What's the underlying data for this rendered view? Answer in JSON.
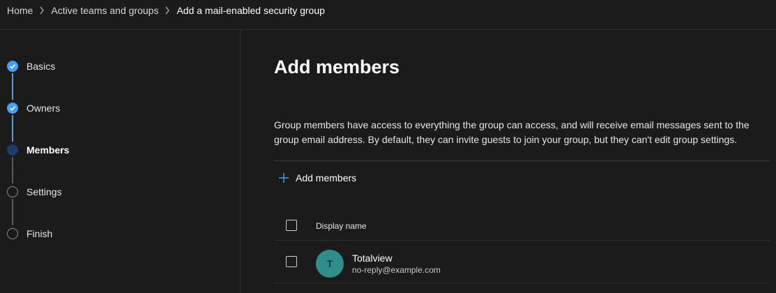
{
  "breadcrumb": {
    "items": [
      "Home",
      "Active teams and groups",
      "Add a mail-enabled security group"
    ]
  },
  "wizard": {
    "steps": [
      {
        "label": "Basics",
        "state": "completed"
      },
      {
        "label": "Owners",
        "state": "completed"
      },
      {
        "label": "Members",
        "state": "current"
      },
      {
        "label": "Settings",
        "state": "pending"
      },
      {
        "label": "Finish",
        "state": "pending"
      }
    ]
  },
  "main": {
    "title": "Add members",
    "description": "Group members have access to everything the group can access, and will receive email messages sent to the group email address. By default, they can invite guests to join your group, but they can't edit group settings.",
    "add_button_label": "Add members",
    "table": {
      "column_header": "Display name",
      "rows": [
        {
          "initial": "T",
          "name": "Totalview",
          "email": "no-reply@example.com",
          "avatar_color": "#2f8d8b"
        }
      ]
    }
  },
  "colors": {
    "background": "#1b1b1b",
    "accent": "#479ef5",
    "current_step": "#1f3d6b",
    "divider": "#2f2f2f"
  }
}
